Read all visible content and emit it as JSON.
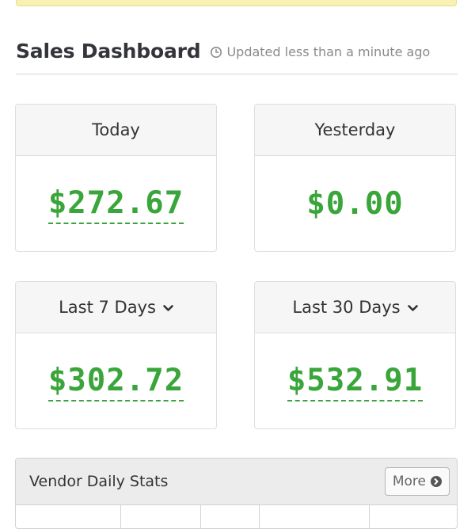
{
  "dashboard": {
    "title": "Sales Dashboard",
    "updated": "Updated less than a minute ago",
    "icons": {
      "updated": "clock-icon",
      "dropdown": "chevron-down-icon",
      "more": "circle-chevron-right-icon"
    },
    "colors": {
      "amount": "#39a53a",
      "notice": "#f7f1b4"
    }
  },
  "cards": {
    "today": {
      "label": "Today",
      "value": "$272.67"
    },
    "yesterday": {
      "label": "Yesterday",
      "value": "$0.00"
    },
    "last7": {
      "label": "Last 7 Days",
      "value": "$302.72"
    },
    "last30": {
      "label": "Last 30 Days",
      "value": "$532.91"
    }
  },
  "vendor": {
    "title": "Vendor Daily Stats",
    "more_label": "More"
  }
}
